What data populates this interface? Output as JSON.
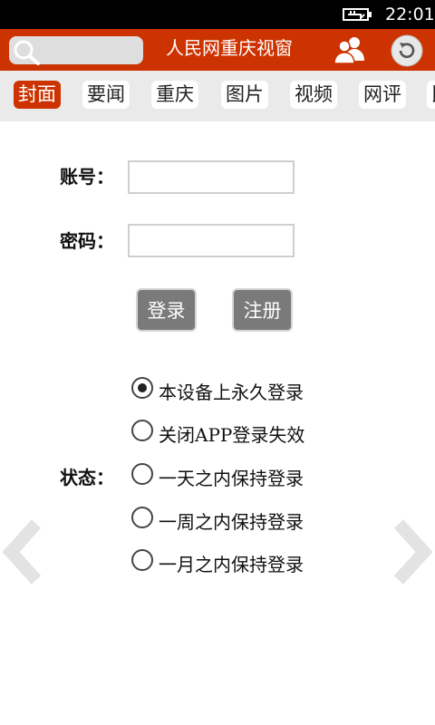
{
  "status_bar": {
    "time": "22:01"
  },
  "header": {
    "title": "人民网重庆视窗"
  },
  "tabs": [
    {
      "label": "封面",
      "active": true
    },
    {
      "label": "要闻",
      "active": false
    },
    {
      "label": "重庆",
      "active": false
    },
    {
      "label": "图片",
      "active": false
    },
    {
      "label": "视频",
      "active": false
    },
    {
      "label": "网评",
      "active": false
    },
    {
      "label": "民",
      "active": false
    }
  ],
  "login": {
    "account_label": "账号：",
    "account_value": "",
    "password_label": "密码：",
    "password_value": "",
    "login_button": "登录",
    "register_button": "注册",
    "state_label": "状态：",
    "options": [
      {
        "label": "本设备上永久登录",
        "checked": true
      },
      {
        "label": "关闭APP登录失效",
        "checked": false
      },
      {
        "label": "一天之内保持登录",
        "checked": false
      },
      {
        "label": "一周之内保持登录",
        "checked": false
      },
      {
        "label": "一月之内保持登录",
        "checked": false
      }
    ]
  },
  "colors": {
    "brand": "#cc3300",
    "button": "#7a7a7a",
    "tab_bar": "#eaeaea"
  }
}
